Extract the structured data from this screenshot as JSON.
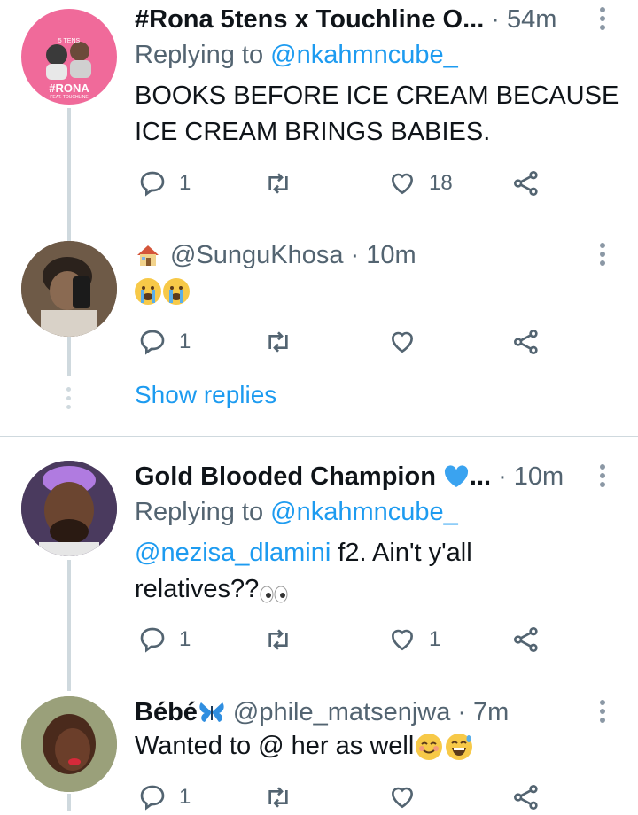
{
  "tweets": [
    {
      "name": "#Rona 5tens x Touchline O...",
      "time": "54m",
      "replying_prefix": "Replying to ",
      "replying_to": "@nkahmncube_",
      "text_line1": "BOOKS BEFORE ICE CREAM BECAUSE",
      "text_line2": "ICE CREAM BRINGS BABIES.",
      "reply_count": "1",
      "like_count": "18",
      "avatar_text": "#RONA",
      "avatar_sub": "5 TENS",
      "avatar_feat": "FEAT. TOUCHLINE"
    },
    {
      "handle": "@SunguKhosa",
      "time": "10m",
      "name_icon": "house-emoji",
      "text_icons": [
        "crying-face-emoji",
        "crying-face-emoji"
      ],
      "reply_count": "1",
      "show_replies": "Show replies"
    },
    {
      "name": "Gold Blooded Champion",
      "name_icon": "blue-heart-emoji",
      "name_suffix": "...",
      "time": "10m",
      "replying_prefix": "Replying to ",
      "replying_to": "@nkahmncube_",
      "mention": "@nezisa_dlamini",
      "text_line1_rest": " f2. Ain't y'all",
      "text_line2": "relatives??",
      "reply_count": "1",
      "like_count": "1"
    },
    {
      "name": "Bébé",
      "name_icon": "butterfly-emoji",
      "handle": "@phile_matsenjwa",
      "time": "7m",
      "text": "Wanted to @ her as well",
      "reply_count": "1"
    }
  ],
  "colors": {
    "link": "#1d9bf0",
    "muted": "#536471",
    "line": "#cfd9de"
  }
}
